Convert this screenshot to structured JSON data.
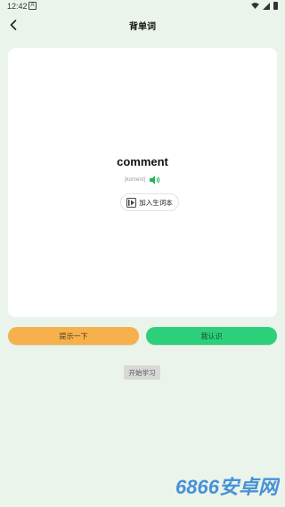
{
  "status_bar": {
    "time": "12:42",
    "notif_glyph": "A",
    "icons": [
      "wifi-icon",
      "signal-icon",
      "battery-icon"
    ]
  },
  "nav": {
    "title": "背单词",
    "back_icon": "chevron-left-icon"
  },
  "card": {
    "word": "comment",
    "phonetic": "[koment]",
    "speaker_icon": "speaker-icon",
    "add_vocab_label": "加入生词本",
    "add_vocab_icon": "book-icon"
  },
  "actions": {
    "hint_label": "提示一下",
    "know_label": "我认识",
    "start_label": "开始学习"
  },
  "watermark": {
    "text": "6866安卓网"
  },
  "colors": {
    "background": "#eaf4ea",
    "card": "#ffffff",
    "hint_button": "#f6b04c",
    "know_button": "#2dd07a",
    "speaker": "#22b35f",
    "watermark": "#2a7fd4"
  }
}
